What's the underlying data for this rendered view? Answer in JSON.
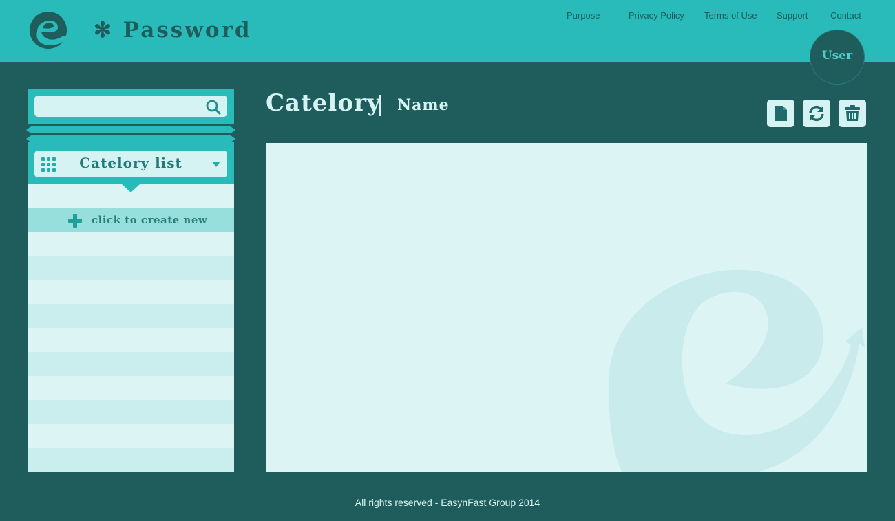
{
  "app": {
    "logo_text": "✻ Password"
  },
  "nav": {
    "items": [
      {
        "label": "Purpose"
      },
      {
        "label": "Privacy Policy"
      },
      {
        "label": "Terms of Use"
      },
      {
        "label": "Support"
      },
      {
        "label": "Contact"
      }
    ]
  },
  "user": {
    "label": "User"
  },
  "sidebar": {
    "search": {
      "value": "",
      "placeholder": "",
      "icon": "search-icon"
    },
    "category_select": {
      "label": "Catelory list",
      "icon": "grid-icon"
    },
    "create_new": {
      "label": "click to create new",
      "icon": "plus-icon"
    }
  },
  "main": {
    "title": "Catelory",
    "subtitle": "Name",
    "toolbar": [
      {
        "icon": "document-icon"
      },
      {
        "icon": "refresh-icon"
      },
      {
        "icon": "trash-icon"
      }
    ]
  },
  "footer": {
    "text": "All rights reserved - EasynFast Group 2014"
  },
  "colors": {
    "header": "#28bbb9",
    "background": "#1f5c5c",
    "panel": "#dcf4f4",
    "accent_text": "#d4f3f2"
  }
}
